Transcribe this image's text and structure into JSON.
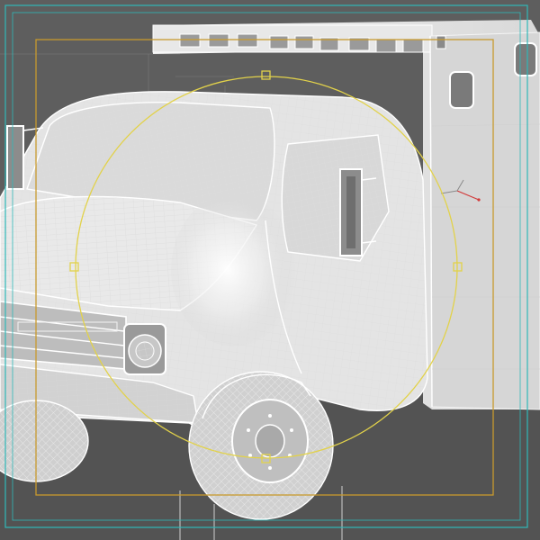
{
  "viewport": {
    "name": "3d-perspective-viewport",
    "colors": {
      "background": "#5e5e5e",
      "ground": "#505050",
      "wireframe": "#e6e6e6",
      "safe_frame": "#2fb8b8",
      "render_region": "#c89a2e",
      "gizmo": "#e2d24a",
      "axis_x": "#d23a3a",
      "axis_y": "#8a8a8a"
    }
  },
  "model": {
    "type": "ambulance-truck-wireframe",
    "shading": "wireframe-on-shaded"
  }
}
